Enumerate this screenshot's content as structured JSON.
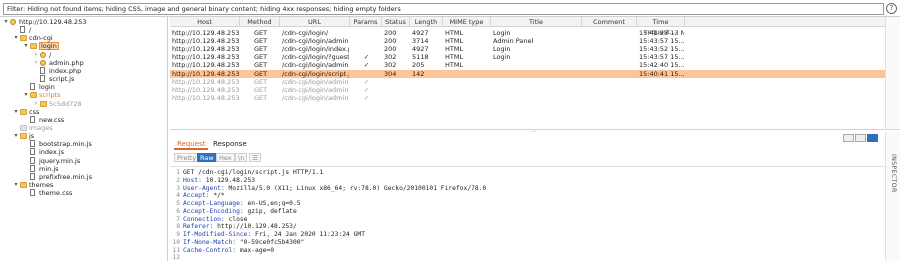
{
  "filter": {
    "text": "Filter: Hiding not found items;  hiding CSS, image and general binary content;  hiding 4xx responses;  hiding empty folders",
    "help_label": "?"
  },
  "tree": [
    {
      "depth": 0,
      "caret": "▾",
      "icon": "gear",
      "label": "http://10.129.48.253",
      "style": ""
    },
    {
      "depth": 1,
      "caret": "",
      "icon": "file",
      "label": "/",
      "style": ""
    },
    {
      "depth": 1,
      "caret": "▾",
      "icon": "folder",
      "label": "cdn-cgi",
      "style": ""
    },
    {
      "depth": 2,
      "caret": "▾",
      "icon": "folder",
      "label": "login",
      "style": "sel"
    },
    {
      "depth": 3,
      "caret": "›",
      "icon": "gear",
      "label": "/",
      "style": ""
    },
    {
      "depth": 3,
      "caret": "›",
      "icon": "gear",
      "label": "admin.php",
      "style": ""
    },
    {
      "depth": 3,
      "caret": "",
      "icon": "file",
      "label": "index.php",
      "style": ""
    },
    {
      "depth": 3,
      "caret": "",
      "icon": "file",
      "label": "script.js",
      "style": ""
    },
    {
      "depth": 2,
      "caret": "",
      "icon": "file",
      "label": "login",
      "style": ""
    },
    {
      "depth": 2,
      "caret": "▾",
      "icon": "folder",
      "label": "scripts",
      "style": "orange"
    },
    {
      "depth": 3,
      "caret": "›",
      "icon": "folder",
      "label": "5c5dd728",
      "style": "grey"
    },
    {
      "depth": 1,
      "caret": "▾",
      "icon": "folder",
      "label": "css",
      "style": ""
    },
    {
      "depth": 2,
      "caret": "",
      "icon": "file",
      "label": "new.css",
      "style": ""
    },
    {
      "depth": 1,
      "caret": "",
      "icon": "folder-grey",
      "label": "images",
      "style": "grey"
    },
    {
      "depth": 1,
      "caret": "▾",
      "icon": "folder",
      "label": "js",
      "style": ""
    },
    {
      "depth": 2,
      "caret": "",
      "icon": "file",
      "label": "bootstrap.min.js",
      "style": ""
    },
    {
      "depth": 2,
      "caret": "",
      "icon": "file",
      "label": "index.js",
      "style": ""
    },
    {
      "depth": 2,
      "caret": "",
      "icon": "file",
      "label": "jquery.min.js",
      "style": ""
    },
    {
      "depth": 2,
      "caret": "",
      "icon": "file",
      "label": "min.js",
      "style": ""
    },
    {
      "depth": 2,
      "caret": "",
      "icon": "file",
      "label": "prefixfree.min.js",
      "style": ""
    },
    {
      "depth": 1,
      "caret": "▾",
      "icon": "folder",
      "label": "themes",
      "style": ""
    },
    {
      "depth": 2,
      "caret": "",
      "icon": "file",
      "label": "theme.css",
      "style": ""
    }
  ],
  "table": {
    "columns": [
      "Host",
      "Method",
      "URL",
      "Params",
      "Status",
      "Length",
      "MIME type",
      "Title",
      "Comment",
      "Time request..."
    ],
    "rows": [
      {
        "host": "http://10.129.48.253",
        "method": "GET",
        "url": "/cdn-cgi/login/",
        "params": "",
        "status": "200",
        "length": "4927",
        "mime": "HTML",
        "title": "Login",
        "comment": "",
        "time": "15:41:23 13 N...",
        "sel": false,
        "dim": false
      },
      {
        "host": "http://10.129.48.253",
        "method": "GET",
        "url": "/cdn-cgi/login/admin.php",
        "params": "",
        "status": "200",
        "length": "3714",
        "mime": "HTML",
        "title": "Admin Panel",
        "comment": "",
        "time": "15:43:57 15...",
        "sel": false,
        "dim": false
      },
      {
        "host": "http://10.129.48.253",
        "method": "GET",
        "url": "/cdn-cgi/login/index.php",
        "params": "",
        "status": "200",
        "length": "4927",
        "mime": "HTML",
        "title": "Login",
        "comment": "",
        "time": "15:43:52 15...",
        "sel": false,
        "dim": false
      },
      {
        "host": "http://10.129.48.253",
        "method": "GET",
        "url": "/cdn-cgi/login/?guest=true",
        "params": "✓",
        "status": "302",
        "length": "5118",
        "mime": "HTML",
        "title": "Login",
        "comment": "",
        "time": "15:43:57 15...",
        "sel": false,
        "dim": false
      },
      {
        "host": "http://10.129.48.253",
        "method": "GET",
        "url": "/cdn-cgi/login/admin.ph...",
        "params": "✓",
        "status": "302",
        "length": "205",
        "mime": "HTML",
        "title": "",
        "comment": "",
        "time": "15:42:40 15...",
        "sel": false,
        "dim": false
      },
      {
        "host": "http://10.129.48.253",
        "method": "GET",
        "url": "/cdn-cgi/login/script.js",
        "params": "",
        "status": "304",
        "length": "142",
        "mime": "",
        "title": "",
        "comment": "",
        "time": "15:40:41 15...",
        "sel": true,
        "dim": false
      },
      {
        "host": "http://10.129.48.253",
        "method": "GET",
        "url": "/cdn-cgi/login/admin.ph...",
        "params": "✓",
        "status": "",
        "length": "",
        "mime": "",
        "title": "",
        "comment": "",
        "time": "",
        "sel": false,
        "dim": true
      },
      {
        "host": "http://10.129.48.253",
        "method": "GET",
        "url": "/cdn-cgi/login/admin.ph...",
        "params": "✓",
        "status": "",
        "length": "",
        "mime": "",
        "title": "",
        "comment": "",
        "time": "",
        "sel": false,
        "dim": true
      },
      {
        "host": "http://10.129.48.253",
        "method": "GET",
        "url": "/cdn-cgi/login/admin.ph...",
        "params": "✓",
        "status": "",
        "length": "",
        "mime": "",
        "title": "",
        "comment": "",
        "time": "",
        "sel": false,
        "dim": true
      }
    ]
  },
  "divider_grip": "⋯",
  "panel": {
    "tabs": [
      "Request",
      "Response"
    ],
    "subtabs": [
      "Pretty",
      "Raw",
      "Hex",
      "\\n",
      "☰"
    ],
    "lines": [
      {
        "n": "1",
        "key": "",
        "val": "GET /cdn-cgi/login/script.js HTTP/1.1"
      },
      {
        "n": "2",
        "key": "Host:",
        "val": " 10.129.48.253"
      },
      {
        "n": "3",
        "key": "User-Agent:",
        "val": " Mozilla/5.0 (X11; Linux x86_64; rv:78.0) Gecko/20100101 Firefox/78.0"
      },
      {
        "n": "4",
        "key": "Accept:",
        "val": " */*"
      },
      {
        "n": "5",
        "key": "Accept-Language:",
        "val": " en-US,en;q=0.5"
      },
      {
        "n": "6",
        "key": "Accept-Encoding:",
        "val": " gzip, deflate"
      },
      {
        "n": "7",
        "key": "Connection:",
        "val": " close"
      },
      {
        "n": "8",
        "key": "Referer:",
        "val": " http://10.129.48.253/"
      },
      {
        "n": "9",
        "key": "If-Modified-Since:",
        "val": " Fri, 24 Jan 2020 11:23:24 GMT"
      },
      {
        "n": "10",
        "key": "If-None-Match:",
        "val": " \"0-59ce0fc5b4300\""
      },
      {
        "n": "11",
        "key": "Cache-Control:",
        "val": " max-age=0"
      },
      {
        "n": "12",
        "key": "",
        "val": ""
      }
    ]
  },
  "inspector_label": "INSPECTOR"
}
